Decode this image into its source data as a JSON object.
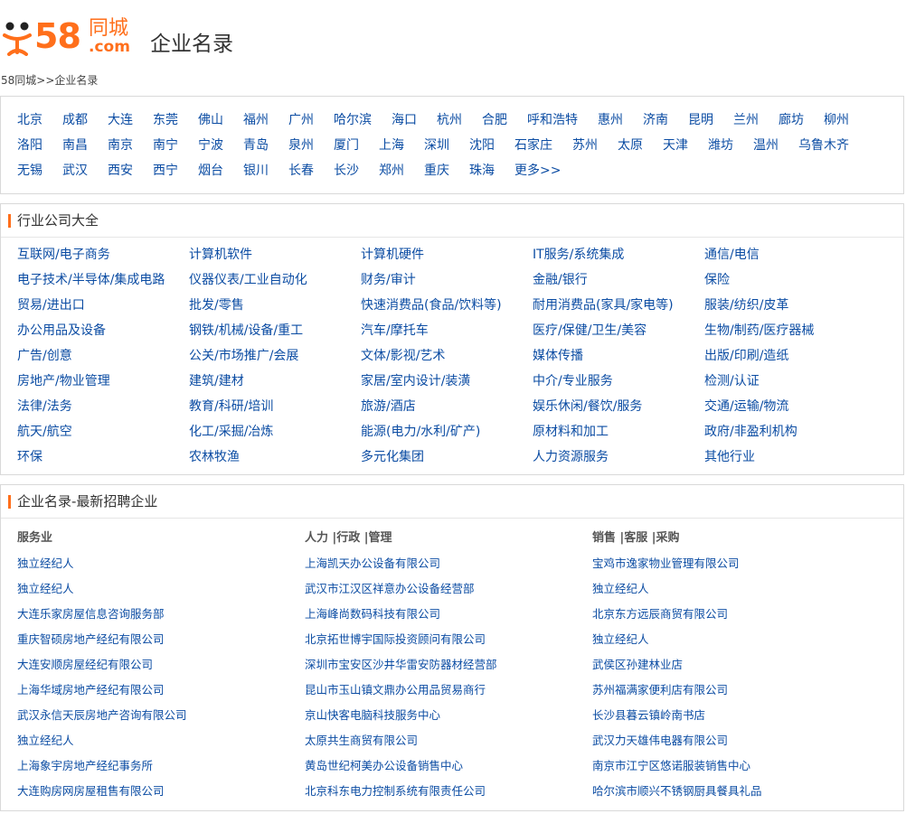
{
  "header": {
    "logo_num": "58",
    "logo_cn": "同城",
    "logo_com": ".com",
    "title": "企业名录"
  },
  "breadcrumb": "58同城>>企业名录",
  "cities": [
    [
      "北京",
      "成都",
      "大连",
      "东莞",
      "佛山",
      "福州",
      "广州",
      "哈尔滨",
      "海口",
      "杭州",
      "合肥",
      "呼和浩特",
      "惠州",
      "济南",
      "昆明",
      "兰州",
      "廊坊",
      "柳州"
    ],
    [
      "洛阳",
      "南昌",
      "南京",
      "南宁",
      "宁波",
      "青岛",
      "泉州",
      "厦门",
      "上海",
      "深圳",
      "沈阳",
      "石家庄",
      "苏州",
      "太原",
      "天津",
      "潍坊",
      "温州",
      "乌鲁木齐"
    ],
    [
      "无锡",
      "武汉",
      "西安",
      "西宁",
      "烟台",
      "银川",
      "长春",
      "长沙",
      "郑州",
      "重庆",
      "珠海",
      "更多>>"
    ]
  ],
  "industry": {
    "title": "行业公司大全",
    "items": [
      "互联网/电子商务",
      "计算机软件",
      "计算机硬件",
      "IT服务/系统集成",
      "通信/电信",
      "电子技术/半导体/集成电路",
      "仪器仪表/工业自动化",
      "财务/审计",
      "金融/银行",
      "保险",
      "贸易/进出口",
      "批发/零售",
      "快速消费品(食品/饮料等)",
      "耐用消费品(家具/家电等)",
      "服装/纺织/皮革",
      "办公用品及设备",
      "钢铁/机械/设备/重工",
      "汽车/摩托车",
      "医疗/保健/卫生/美容",
      "生物/制药/医疗器械",
      "广告/创意",
      "公关/市场推广/会展",
      "文体/影视/艺术",
      "媒体传播",
      "出版/印刷/造纸",
      "房地产/物业管理",
      "建筑/建材",
      "家居/室内设计/装潢",
      "中介/专业服务",
      "检测/认证",
      "法律/法务",
      "教育/科研/培训",
      "旅游/酒店",
      "娱乐休闲/餐饮/服务",
      "交通/运输/物流",
      "航天/航空",
      "化工/采掘/冶炼",
      "能源(电力/水利/矿产)",
      "原材料和加工",
      "政府/非盈利机构",
      "环保",
      "农林牧渔",
      "多元化集团",
      "人力资源服务",
      "其他行业"
    ]
  },
  "enterprise": {
    "title": "企业名录-最新招聘企业",
    "columns": [
      {
        "head": "服务业",
        "items": [
          "独立经纪人",
          "独立经纪人",
          "大连乐家房屋信息咨询服务部",
          "重庆智硕房地产经纪有限公司",
          "大连安顺房屋经纪有限公司",
          "上海华域房地产经纪有限公司",
          "武汉永信天辰房地产咨询有限公司",
          "独立经纪人",
          "上海象宇房地产经纪事务所",
          "大连购房网房屋租售有限公司"
        ]
      },
      {
        "head": "人力 |行政 |管理",
        "items": [
          "上海凯天办公设备有限公司",
          "武汉市江汉区祥意办公设备经营部",
          "上海峰尚数码科技有限公司",
          "北京拓世博宇国际投资顾问有限公司",
          "深圳市宝安区沙井华雷安防器材经营部",
          "昆山市玉山镇文鼎办公用品贸易商行",
          "京山快客电脑科技服务中心",
          "太原共生商贸有限公司",
          "黄岛世纪柯美办公设备销售中心",
          "北京科东电力控制系统有限责任公司"
        ]
      },
      {
        "head": "销售 |客服 |采购",
        "items": [
          "宝鸡市逸家物业管理有限公司",
          "独立经纪人",
          "北京东方远辰商贸有限公司",
          "独立经纪人",
          "武侯区孙建林业店",
          "苏州福满家便利店有限公司",
          "长沙县暮云镇岭南书店",
          "武汉力天雄伟电器有限公司",
          "南京市江宁区悠诺服装销售中心",
          "哈尔滨市顺兴不锈钢厨具餐具礼品"
        ]
      }
    ]
  },
  "colors": {
    "brand": "#ff6f1b",
    "link": "#0b4ca3"
  }
}
